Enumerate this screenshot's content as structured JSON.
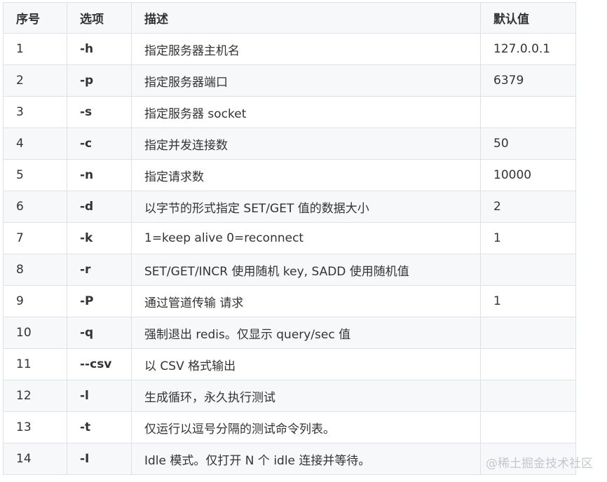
{
  "table": {
    "headers": [
      "序号",
      "选项",
      "描述",
      "默认值"
    ],
    "rows": [
      {
        "no": "1",
        "option": "-h",
        "desc": "指定服务器主机名",
        "default": "127.0.0.1"
      },
      {
        "no": "2",
        "option": "-p",
        "desc": "指定服务器端口",
        "default": "6379"
      },
      {
        "no": "3",
        "option": "-s",
        "desc": "指定服务器 socket",
        "default": ""
      },
      {
        "no": "4",
        "option": "-c",
        "desc": "指定并发连接数",
        "default": "50"
      },
      {
        "no": "5",
        "option": "-n",
        "desc": "指定请求数",
        "default": "10000"
      },
      {
        "no": "6",
        "option": "-d",
        "desc": "以字节的形式指定 SET/GET 值的数据大小",
        "default": "2"
      },
      {
        "no": "7",
        "option": "-k",
        "desc": "1=keep alive 0=reconnect",
        "default": "1"
      },
      {
        "no": "8",
        "option": "-r",
        "desc": "SET/GET/INCR 使用随机 key, SADD 使用随机值",
        "default": ""
      },
      {
        "no": "9",
        "option": "-P",
        "desc": "通过管道传输 请求",
        "default": "1"
      },
      {
        "no": "10",
        "option": "-q",
        "desc": "强制退出 redis。仅显示 query/sec 值",
        "default": ""
      },
      {
        "no": "11",
        "option": "--csv",
        "desc": "以 CSV 格式输出",
        "default": ""
      },
      {
        "no": "12",
        "option": "-l",
        "desc": "生成循环，永久执行测试",
        "default": ""
      },
      {
        "no": "13",
        "option": "-t",
        "desc": "仅运行以逗号分隔的测试命令列表。",
        "default": ""
      },
      {
        "no": "14",
        "option": "-I",
        "desc": "Idle 模式。仅打开 N 个 idle 连接并等待。",
        "default": ""
      }
    ]
  },
  "watermark": "@稀土掘金技术社区"
}
